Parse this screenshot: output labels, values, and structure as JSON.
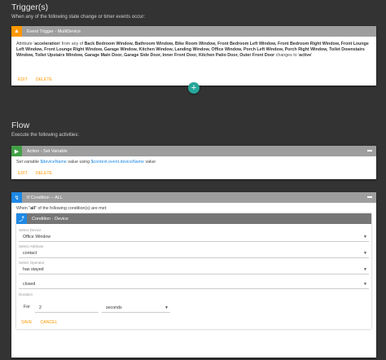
{
  "triggers": {
    "title": "Trigger(s)",
    "subtitle": "When any of the following state change or timer events occur:",
    "card": {
      "header": "Event Trigger - MultiDevice",
      "icon": "bell-icon",
      "text_pre": "Attribute '",
      "attribute": "acceleration",
      "text_mid": "' from any of ",
      "devices": "Back Bedroom Window, Bathroom Window, Bike Room Window, Front Bedroom Left Window, Front Bedroom Right Window, Front Lounge Left Window, Front Lounge Right Window, Garage Window, Kitchen Window, Landing Window, Office Window, Porch Left Window, Porch Right Window, Toilet Downstairs Window, Toilet Upstairs Window, Garage Main Door, Garage Side Door, Inner Front Door, Kitchen Patio Door, Outer Front Door",
      "text_post": " changes to '",
      "value": "active",
      "text_end": "'",
      "edit_label": "EDIT",
      "delete_label": "DELETE"
    },
    "add_button": "+"
  },
  "flow": {
    "title": "Flow",
    "subtitle": "Execute the following activities:",
    "action": {
      "header": "Action - Set Variable",
      "icon": "play-icon",
      "text_pre": "Set variable ",
      "variable": "$deviceName",
      "text_mid": " value using ",
      "expression": "$context.event.deviceName",
      "text_end": " value",
      "edit_label": "EDIT",
      "delete_label": "DELETE"
    },
    "if_block": {
      "header": "If Condition -- ALL",
      "icon": "branch-icon",
      "intro_pre": "When \"",
      "intro_all": "all",
      "intro_post": "\" of the following condition(s) are met:",
      "condition": {
        "header": "Condition - Device",
        "icon": "device-icon",
        "device_label": "Select Device",
        "device_value": "Office Window",
        "attribute_label": "Select Attribute",
        "attribute_value": "contact",
        "operator_label": "Select Operator",
        "operator_value": "has stayed",
        "state_value": "closed",
        "duration_label": "Duration",
        "for_label": "For",
        "duration_value": "2",
        "unit_value": "seconds",
        "save_label": "SAVE",
        "cancel_label": "CANCEL"
      }
    }
  }
}
